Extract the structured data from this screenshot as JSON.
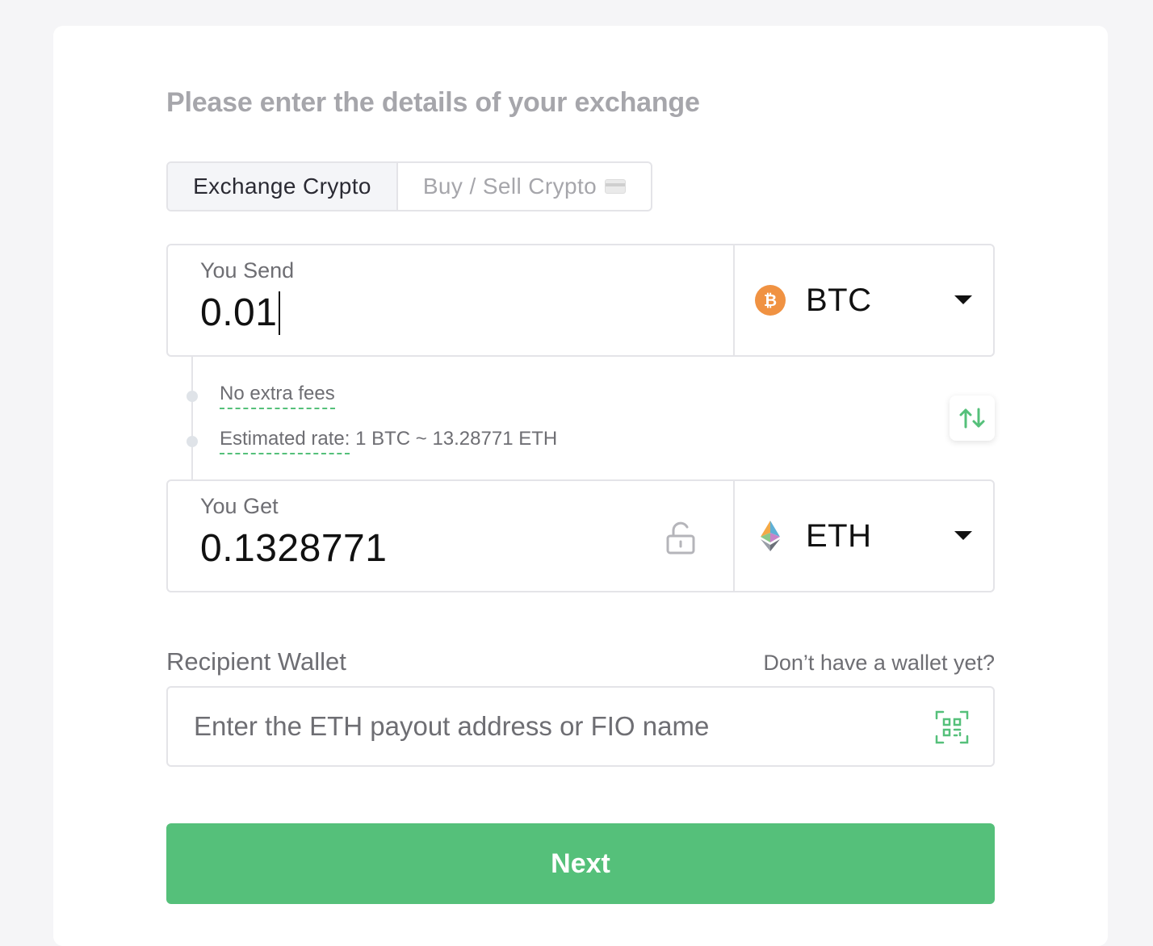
{
  "header": {
    "title": "Please enter the details of your exchange"
  },
  "tabs": [
    {
      "label": "Exchange Crypto",
      "active": true
    },
    {
      "label": "Buy / Sell Crypto",
      "icon": "credit-card-icon",
      "active": false
    }
  ],
  "send": {
    "label": "You Send",
    "value": "0.01",
    "currency": "BTC",
    "currency_icon": "bitcoin-icon",
    "currency_color": "#f09242"
  },
  "info": {
    "fees": "No extra fees",
    "rate_label": "Estimated rate:",
    "rate_value": "1 BTC ~ 13.28771 ETH"
  },
  "get": {
    "label": "You Get",
    "value": "0.1328771",
    "currency": "ETH",
    "currency_icon": "ethereum-icon",
    "lock_icon": "unlock-icon"
  },
  "wallet": {
    "label": "Recipient Wallet",
    "help_link": "Don’t have a wallet yet?",
    "placeholder": "Enter the ETH payout address or FIO name",
    "value": "",
    "scan_icon": "qr-scan-icon"
  },
  "actions": {
    "next_label": "Next"
  },
  "colors": {
    "accent": "#55c07a",
    "muted_text": "#6e6e73",
    "title_text": "#a6a6ab",
    "border": "#e4e4e8"
  }
}
